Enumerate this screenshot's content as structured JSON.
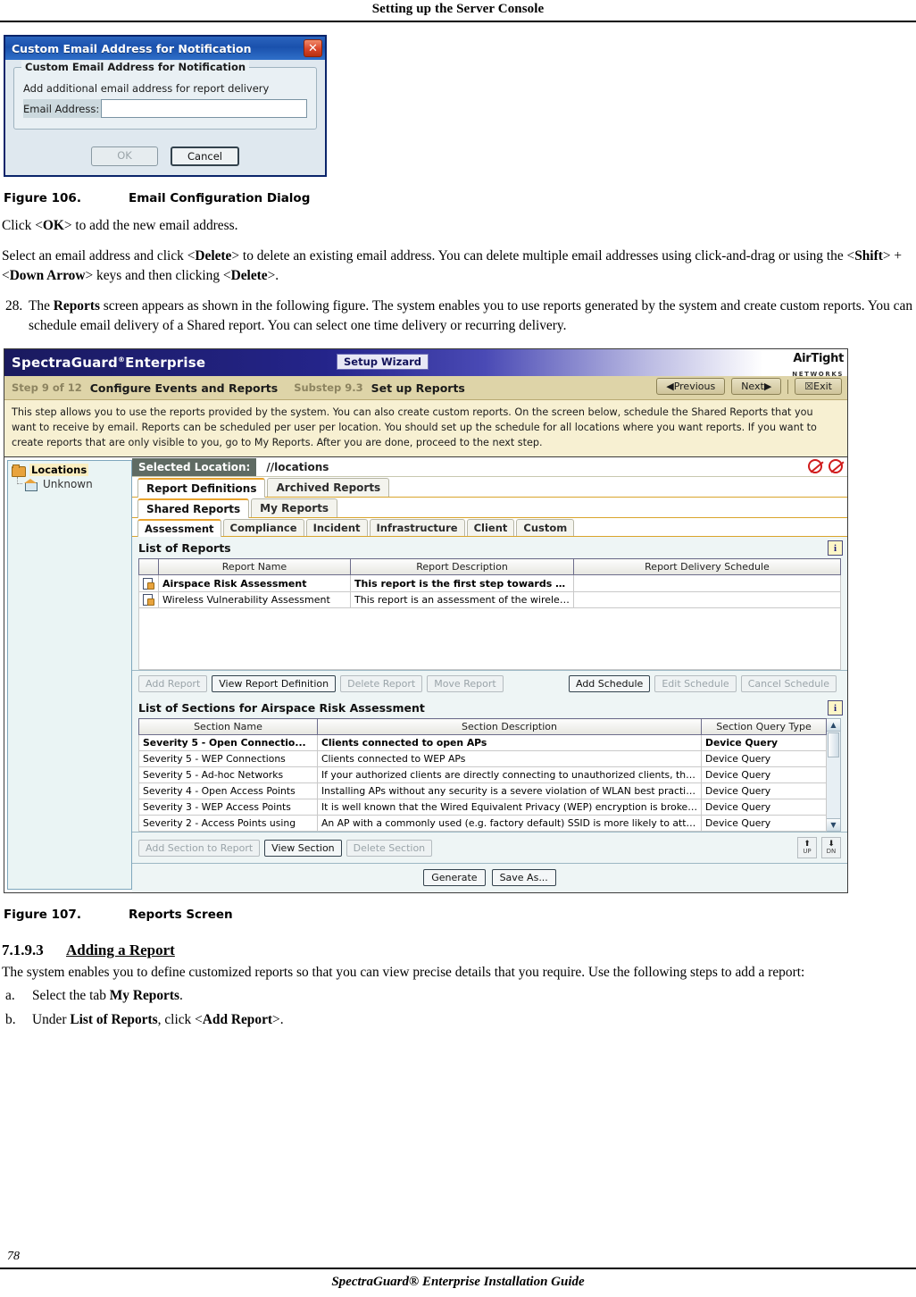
{
  "page": {
    "running_head": "Setting up the Server Console",
    "page_number": "78",
    "footer_title": "SpectraGuard® Enterprise Installation Guide"
  },
  "dialog": {
    "title": "Custom Email Address for Notification",
    "close_icon": "close-icon",
    "legend": "Custom Email Address for Notification",
    "description": "Add additional email address for report delivery",
    "field_label": "Email Address:",
    "field_value": "",
    "ok_label": "OK",
    "cancel_label": "Cancel"
  },
  "figure106": {
    "number": "Figure  106.",
    "title": "Email Configuration Dialog"
  },
  "figure107": {
    "number": "Figure  107.",
    "title": "Reports Screen"
  },
  "body": {
    "para1": "Click <OK> to add the new email address.",
    "para1_parts": [
      "Click <",
      "OK",
      "> to add the new email address."
    ],
    "para2_a": "Select an email address and click <",
    "para2_b": "Delete",
    "para2_c": "> to delete an existing email address. You can delete multiple email addresses using click-and-drag or using the <",
    "para2_d": "Shift",
    "para2_e": "> + <",
    "para2_f": "Down Arrow",
    "para2_g": "> keys and then clicking <",
    "para2_h": "Delete",
    "para2_i": ">.",
    "item28_num": "28.",
    "item28_a": "The ",
    "item28_b": "Reports",
    "item28_c": " screen appears as shown in the following figure. The system enables you to use reports generated by the system and create custom reports. You can schedule email delivery of a Shared report. You can select one time delivery or recurring delivery.",
    "section_number": "7.1.9.3",
    "section_title": "Adding a Report",
    "para3": "The system enables you to define customized reports so that you can view precise details that you require. Use the following steps to add a report:",
    "step_a_num": "a.",
    "step_a_1": "Select the tab ",
    "step_a_2": "My Reports",
    "step_a_3": ".",
    "step_b_num": "b.",
    "step_b_1": "Under ",
    "step_b_2": "List of Reports",
    "step_b_3": ", click <",
    "step_b_4": "Add Report",
    "step_b_5": ">."
  },
  "app": {
    "brand": "SpectraGuard",
    "brand_sup": "®",
    "brand_suffix": "Enterprise",
    "wizard_chip": "Setup Wizard",
    "logo_line1": "AirTight",
    "logo_line2": "NETWORKS",
    "step_label": "Step 9 of 12",
    "step_title": "Configure Events and Reports",
    "substep_label": "Substep 9.3",
    "substep_title": "Set up Reports",
    "nav": {
      "previous": "◀Previous",
      "next": "Next▶",
      "exit": "☒Exit"
    },
    "instructions": "This step allows you to use the reports provided by the system. You can also create custom reports. On the screen below, schedule the Shared Reports that you want to receive by email. Reports can be scheduled per user per location. You should set up the schedule for all locations where you want reports. If you want to create reports that are only visible to you, go to My Reports. After you are done, proceed to the next step.",
    "locations": {
      "root": "Locations",
      "child": "Unknown",
      "root_icon": "folder-icon",
      "child_icon": "home-icon"
    },
    "selected_location_label": "Selected Location:",
    "selected_location_value": "//locations",
    "status_icons": [
      "sensor-disabled-icon",
      "server-disabled-icon"
    ],
    "tabs_level1": [
      {
        "label": "Report Definitions",
        "active": true
      },
      {
        "label": "Archived Reports",
        "active": false
      }
    ],
    "tabs_level2": [
      {
        "label": "Shared Reports",
        "active": true
      },
      {
        "label": "My Reports",
        "active": false
      }
    ],
    "tabs_level3": [
      {
        "label": "Assessment",
        "active": true
      },
      {
        "label": "Compliance",
        "active": false
      },
      {
        "label": "Incident",
        "active": false
      },
      {
        "label": "Infrastructure",
        "active": false
      },
      {
        "label": "Client",
        "active": false
      },
      {
        "label": "Custom",
        "active": false
      }
    ],
    "reports_section": {
      "title": "List of Reports",
      "info_icon": "info-icon",
      "columns": [
        "",
        "Report Name",
        "Report Description",
        "Report Delivery Schedule"
      ],
      "rows": [
        {
          "icon": "report-icon",
          "name": "Airspace Risk Assessment",
          "description": "This report is the first step towards wireless ...",
          "schedule": "",
          "selected": true
        },
        {
          "icon": "report-icon",
          "name": "Wireless Vulnerability Assessment",
          "description": "This report is an assessment of the wireless securit...",
          "schedule": "",
          "selected": false
        }
      ],
      "buttons_left": [
        {
          "label": "Add Report",
          "enabled": false
        },
        {
          "label": "View Report Definition",
          "enabled": true
        },
        {
          "label": "Delete Report",
          "enabled": false
        },
        {
          "label": "Move Report",
          "enabled": false
        }
      ],
      "buttons_right": [
        {
          "label": "Add Schedule",
          "enabled": true
        },
        {
          "label": "Edit Schedule",
          "enabled": false
        },
        {
          "label": "Cancel Schedule",
          "enabled": false
        }
      ]
    },
    "sections_section": {
      "title": "List of Sections for Airspace Risk Assessment",
      "info_icon": "info-icon",
      "columns": [
        "Section Name",
        "Section Description",
        "Section Query Type"
      ],
      "rows": [
        {
          "name": "Severity 5 - Open Connectio...",
          "description": "Clients connected to open APs",
          "query_type": "Device Query",
          "selected": true
        },
        {
          "name": "Severity 5 - WEP Connections",
          "description": "Clients connected to WEP APs",
          "query_type": "Device Query",
          "selected": false
        },
        {
          "name": "Severity 5 - Ad-hoc Networks",
          "description": "If your authorized clients are directly connecting to unauthorized clients, then it i...",
          "query_type": "Device Query",
          "selected": false
        },
        {
          "name": "Severity 4 - Open Access Points",
          "description": "Installing APs without any security is a severe violation of WLAN best practices. ...",
          "query_type": "Device Query",
          "selected": false
        },
        {
          "name": "Severity 3 - WEP Access Points",
          "description": "It is well known that the Wired Equivalent Privacy (WEP) encryption is broken. If ...",
          "query_type": "Device Query",
          "selected": false
        },
        {
          "name": "Severity 2 - Access Points using",
          "description": "An AP with a commonly used (e.g. factory default) SSID is more likely to attract...",
          "query_type": "Device Query",
          "selected": false
        }
      ],
      "buttons": [
        {
          "label": "Add Section to Report",
          "enabled": false
        },
        {
          "label": "View Section",
          "enabled": true
        },
        {
          "label": "Delete Section",
          "enabled": false
        }
      ],
      "move_up_label": "UP",
      "move_down_label": "DN"
    },
    "generate_label": "Generate",
    "save_as_label": "Save As..."
  },
  "colors": {
    "dialog_title_blue": "#1a51ad",
    "app_header_navy": "#1a1a5e",
    "app_step_tan": "#ded4a8",
    "instructions_cream": "#f7f0d2",
    "tab_accent_orange": "#e8a32d",
    "selected_location_bg": "#5f6b63",
    "status_red": "#d01c1c"
  }
}
